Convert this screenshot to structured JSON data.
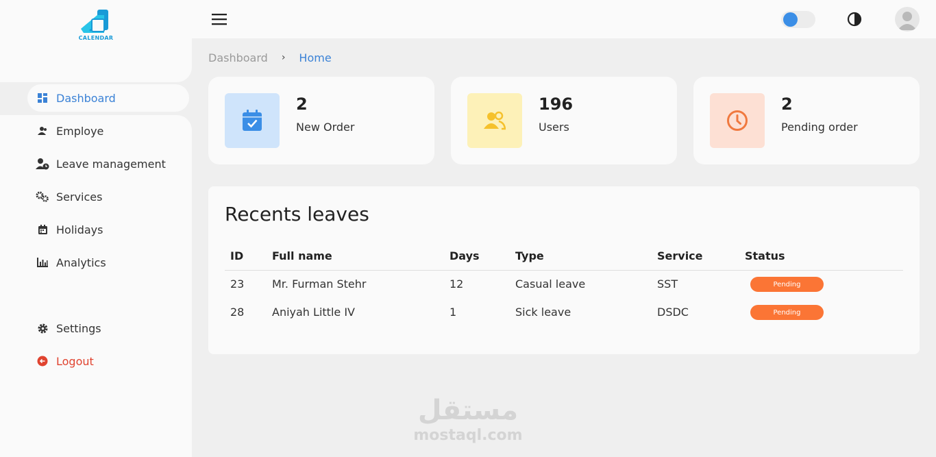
{
  "brand": {
    "logo_text": "CALENDAR"
  },
  "sidebar": {
    "items": [
      {
        "label": "Dashboard",
        "icon": "dashboard-icon",
        "active": true
      },
      {
        "label": "Employe",
        "icon": "users-icon"
      },
      {
        "label": "Leave management",
        "icon": "user-clock-icon"
      },
      {
        "label": "Services",
        "icon": "gears-icon"
      },
      {
        "label": "Holidays",
        "icon": "calendar-icon"
      },
      {
        "label": "Analytics",
        "icon": "bar-chart-icon"
      }
    ],
    "settings_label": "Settings",
    "logout_label": "Logout"
  },
  "header": {
    "menu_icon": "hamburger-icon",
    "theme_toggle_icon": "contrast-icon",
    "avatar_icon": "user-avatar-icon"
  },
  "breadcrumb": {
    "parent": "Dashboard",
    "separator": "›",
    "current": "Home"
  },
  "stats": [
    {
      "value": "2",
      "label": "New Order",
      "icon": "calendar-check-icon",
      "bg": "#cfe4fb",
      "fg": "#3b8ee6"
    },
    {
      "value": "196",
      "label": "Users",
      "icon": "users-icon",
      "bg": "#fdf1b8",
      "fg": "#f5c12c"
    },
    {
      "value": "2",
      "label": "Pending order",
      "icon": "clock-icon",
      "bg": "#fde0d4",
      "fg": "#f0793f"
    }
  ],
  "recent_leaves": {
    "title": "Recents leaves",
    "columns": [
      "ID",
      "Full name",
      "Days",
      "Type",
      "Service",
      "Status"
    ],
    "rows": [
      {
        "id": "23",
        "name": "Mr. Furman Stehr",
        "days": "12",
        "type": "Casual leave",
        "service": "SST",
        "status": "Pending"
      },
      {
        "id": "28",
        "name": "Aniyah Little IV",
        "days": "1",
        "type": "Sick leave",
        "service": "DSDC",
        "status": "Pending"
      }
    ]
  },
  "watermark": {
    "arabic": "مستقل",
    "latin": "mostaql.com"
  },
  "colors": {
    "accent": "#3b82d6",
    "logout": "#e0432f",
    "badge": "#fb7535"
  }
}
